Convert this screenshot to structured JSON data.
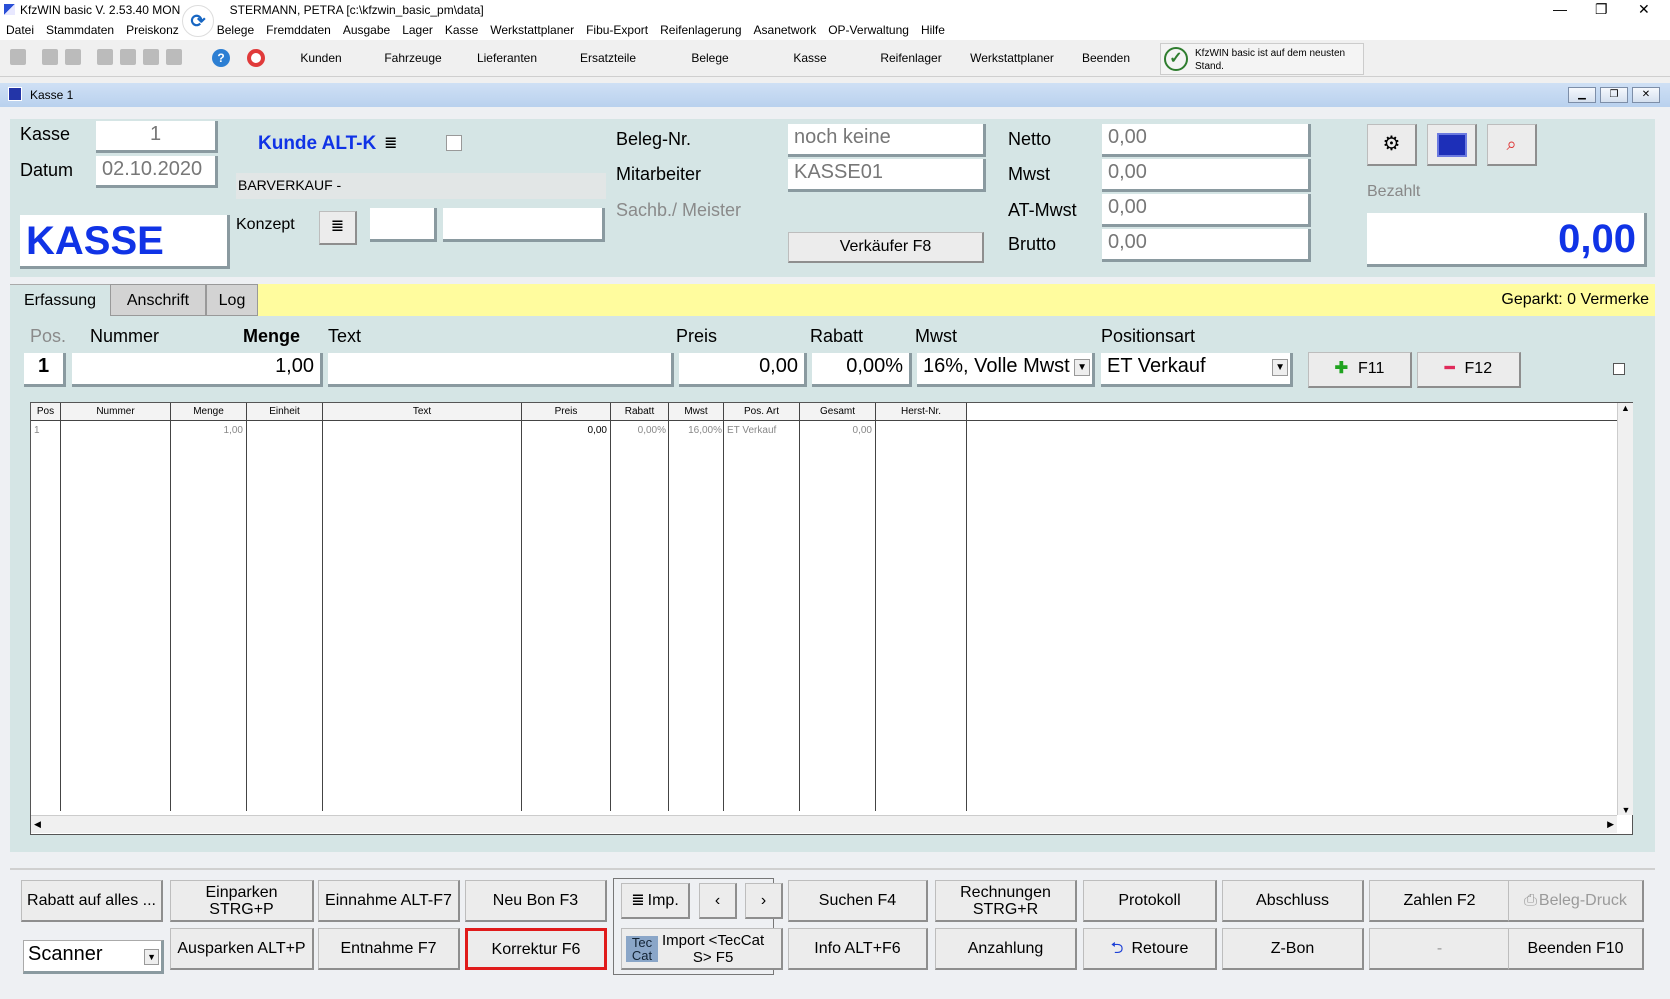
{
  "window": {
    "title": "KfzWIN basic V. 2.53.40 MON",
    "title_suffix": "STERMANN, PETRA [c:\\kfzwin_basic_pm\\data]"
  },
  "menu": [
    "Datei",
    "Stammdaten",
    "Preiskonz",
    "Belege",
    "Fremddaten",
    "Ausgabe",
    "Lager",
    "Kasse",
    "Werkstattplaner",
    "Fibu-Export",
    "Reifenlagerung",
    "Asanetwork",
    "OP-Verwaltung",
    "Hilfe"
  ],
  "toolbar": {
    "buttons": [
      "Kunden",
      "Fahrzeuge",
      "Lieferanten",
      "Ersatzteile",
      "Belege",
      "Kasse",
      "Reifenlager",
      "Werkstattplaner",
      "Beenden"
    ],
    "update_text": "KfzWIN basic ist auf dem neusten Stand."
  },
  "inner_window": {
    "title": "Kasse 1"
  },
  "header": {
    "kasse_label": "Kasse",
    "kasse_value": "1",
    "datum_label": "Datum",
    "datum_value": "02.10.2020",
    "big_label": "KASSE",
    "kunde_link": "Kunde ALT-K",
    "customer": "BARVERKAUF -",
    "konzept_label": "Konzept",
    "beleg_label": "Beleg-Nr.",
    "beleg_value": "noch keine",
    "mitarbeiter_label": "Mitarbeiter",
    "mitarbeiter_value": "KASSE01",
    "sachb_label": "Sachb./ Meister",
    "verkaeufer_button": "Verkäufer F8",
    "netto_label": "Netto",
    "netto_value": "0,00",
    "mwst_label": "Mwst",
    "mwst_value": "0,00",
    "atmwst_label": "AT-Mwst",
    "atmwst_value": "0,00",
    "brutto_label": "Brutto",
    "brutto_value": "0,00",
    "bezahlt_label": "Bezahlt",
    "bezahlt_value": "0,00"
  },
  "tabs": [
    "Erfassung",
    "Anschrift",
    "Log"
  ],
  "geparkt": "Geparkt: 0 Vermerke",
  "entry": {
    "labels": {
      "pos": "Pos.",
      "nummer": "Nummer",
      "menge": "Menge",
      "text": "Text",
      "preis": "Preis",
      "rabatt": "Rabatt",
      "mwst": "Mwst",
      "positionsart": "Positionsart"
    },
    "pos": "1",
    "nummer": "",
    "menge": "1,00",
    "text": "",
    "preis": "0,00",
    "rabatt": "0,00%",
    "mwst": "16%, Volle Mwst",
    "positionsart": "ET Verkauf",
    "add_button": "F11",
    "remove_button": "F12"
  },
  "grid": {
    "headers": [
      "Pos",
      "Nummer",
      "Menge",
      "Einheit",
      "Text",
      "Preis",
      "Rabatt",
      "Mwst",
      "Pos. Art",
      "Gesamt",
      "Herst-Nr."
    ],
    "row": {
      "pos": "1",
      "menge": "1,00",
      "preis": "0,00",
      "rabatt": "0,00%",
      "mwst": "16,00%",
      "posart": "ET Verkauf",
      "gesamt": "0,00"
    }
  },
  "bottom": {
    "rabatt": "Rabatt auf alles ...",
    "einparken_1": "Einparken",
    "einparken_2": "STRG+P",
    "einnahme": "Einnahme ALT-F7",
    "neubon": "Neu Bon F3",
    "imp": "Imp.",
    "suchen": "Suchen F4",
    "rechnungen_1": "Rechnungen",
    "rechnungen_2": "STRG+R",
    "protokoll": "Protokoll",
    "abschluss": "Abschluss",
    "zahlen": "Zahlen F2",
    "belegdruck": "Beleg-Druck",
    "scanner": "Scanner",
    "ausparken": "Ausparken ALT+P",
    "entnahme": "Entnahme F7",
    "korrektur": "Korrektur F6",
    "tec_1": "Tec",
    "tec_2": "Cat",
    "import_1": "Import <TecCat",
    "import_2": "S> F5",
    "info": "Info ALT+F6",
    "anzahlung": "Anzahlung",
    "retoure": "Retoure",
    "zbon": "Z-Bon",
    "dash": "-",
    "beenden": "Beenden F10"
  }
}
